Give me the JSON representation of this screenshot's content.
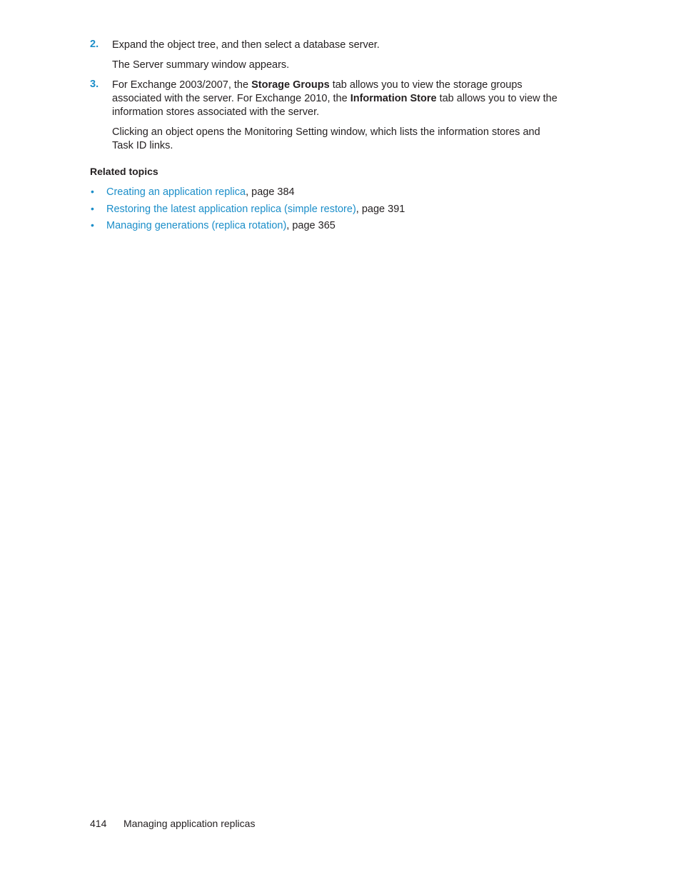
{
  "steps": [
    {
      "number": "2.",
      "lines": [
        "Expand the object tree, and then select a database server."
      ],
      "result": "The Server summary window appears."
    },
    {
      "number": "3.",
      "line1_a": "For Exchange 2003/2007, the ",
      "line1_bold": "Storage Groups",
      "line1_b": " tab allows you to view the storage groups",
      "line2_a": "associated with the server. For Exchange 2010, the ",
      "line2_bold": "Information Store",
      "line2_b": " tab allows you to view the",
      "line3": "information stores associated with the server.",
      "note_line1": "Clicking an object opens the Monitoring Setting window, which lists the information stores and",
      "note_line2": "Task ID links."
    }
  ],
  "related_topics": {
    "heading": "Related topics",
    "bullet": "•",
    "items": [
      {
        "link": "Creating an application replica",
        "suffix": ", page 384"
      },
      {
        "link": "Restoring the latest application replica (simple restore)",
        "suffix": ", page 391"
      },
      {
        "link": "Managing generations (replica rotation)",
        "suffix": ", page 365"
      }
    ]
  },
  "footer": {
    "page_number": "414",
    "chapter_title": "Managing application replicas"
  }
}
